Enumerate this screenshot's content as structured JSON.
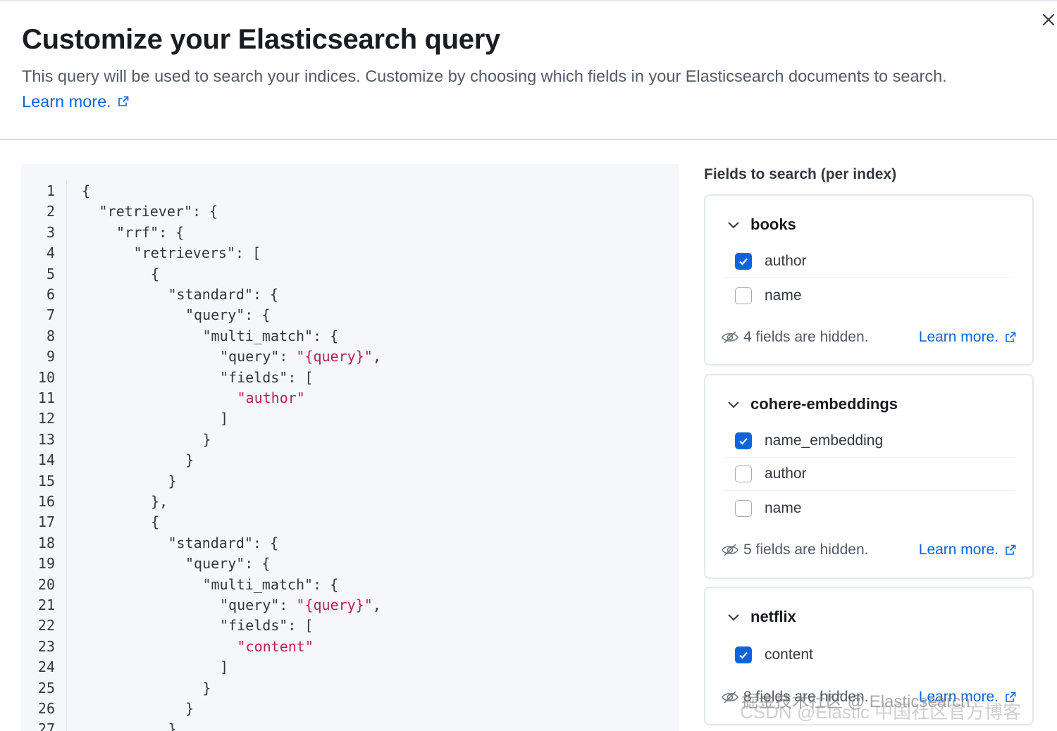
{
  "modal": {
    "title": "Customize your Elasticsearch query",
    "subtitle": "This query will be used to search your indices. Customize by choosing which fields in your Elasticsearch documents to search.",
    "learn_more": "Learn more."
  },
  "editor": {
    "lines": [
      {
        "n": "1",
        "indent": 0,
        "parts": [
          {
            "t": "{"
          }
        ]
      },
      {
        "n": "2",
        "indent": 1,
        "parts": [
          {
            "t": "\"retriever\": {"
          }
        ]
      },
      {
        "n": "3",
        "indent": 2,
        "parts": [
          {
            "t": "\"rrf\": {"
          }
        ]
      },
      {
        "n": "4",
        "indent": 3,
        "parts": [
          {
            "t": "\"retrievers\": ["
          }
        ]
      },
      {
        "n": "5",
        "indent": 4,
        "parts": [
          {
            "t": "{"
          }
        ]
      },
      {
        "n": "6",
        "indent": 5,
        "parts": [
          {
            "t": "\"standard\": {"
          }
        ]
      },
      {
        "n": "7",
        "indent": 6,
        "parts": [
          {
            "t": "\"query\": {"
          }
        ]
      },
      {
        "n": "8",
        "indent": 7,
        "parts": [
          {
            "t": "\"multi_match\": {"
          }
        ]
      },
      {
        "n": "9",
        "indent": 8,
        "parts": [
          {
            "t": "\"query\": "
          },
          {
            "t": "\"{query}\"",
            "s": true
          },
          {
            "t": ","
          }
        ]
      },
      {
        "n": "10",
        "indent": 8,
        "parts": [
          {
            "t": "\"fields\": ["
          }
        ]
      },
      {
        "n": "11",
        "indent": 9,
        "parts": [
          {
            "t": "\"author\"",
            "s": true
          }
        ]
      },
      {
        "n": "12",
        "indent": 8,
        "parts": [
          {
            "t": "]"
          }
        ]
      },
      {
        "n": "13",
        "indent": 7,
        "parts": [
          {
            "t": "}"
          }
        ]
      },
      {
        "n": "14",
        "indent": 6,
        "parts": [
          {
            "t": "}"
          }
        ]
      },
      {
        "n": "15",
        "indent": 5,
        "parts": [
          {
            "t": "}"
          }
        ]
      },
      {
        "n": "16",
        "indent": 4,
        "parts": [
          {
            "t": "},"
          }
        ]
      },
      {
        "n": "17",
        "indent": 4,
        "parts": [
          {
            "t": "{"
          }
        ]
      },
      {
        "n": "18",
        "indent": 5,
        "parts": [
          {
            "t": "\"standard\": {"
          }
        ]
      },
      {
        "n": "19",
        "indent": 6,
        "parts": [
          {
            "t": "\"query\": {"
          }
        ]
      },
      {
        "n": "20",
        "indent": 7,
        "parts": [
          {
            "t": "\"multi_match\": {"
          }
        ]
      },
      {
        "n": "21",
        "indent": 8,
        "parts": [
          {
            "t": "\"query\": "
          },
          {
            "t": "\"{query}\"",
            "s": true
          },
          {
            "t": ","
          }
        ]
      },
      {
        "n": "22",
        "indent": 8,
        "parts": [
          {
            "t": "\"fields\": ["
          }
        ]
      },
      {
        "n": "23",
        "indent": 9,
        "parts": [
          {
            "t": "\"content\"",
            "s": true
          }
        ]
      },
      {
        "n": "24",
        "indent": 8,
        "parts": [
          {
            "t": "]"
          }
        ]
      },
      {
        "n": "25",
        "indent": 7,
        "parts": [
          {
            "t": "}"
          }
        ]
      },
      {
        "n": "26",
        "indent": 6,
        "parts": [
          {
            "t": "}"
          }
        ]
      },
      {
        "n": "27",
        "indent": 5,
        "parts": [
          {
            "t": "}"
          }
        ]
      }
    ]
  },
  "fields_panel": {
    "title": "Fields to search (per index)",
    "indices": [
      {
        "name": "books",
        "fields": [
          {
            "label": "author",
            "checked": true
          },
          {
            "label": "name",
            "checked": false
          }
        ],
        "hidden_text": "4 fields are hidden.",
        "learn_more": "Learn more."
      },
      {
        "name": "cohere-embeddings",
        "fields": [
          {
            "label": "name_embedding",
            "checked": true
          },
          {
            "label": "author",
            "checked": false
          },
          {
            "label": "name",
            "checked": false
          }
        ],
        "hidden_text": "5 fields are hidden.",
        "learn_more": "Learn more."
      },
      {
        "name": "netflix",
        "fields": [
          {
            "label": "content",
            "checked": true
          }
        ],
        "hidden_text": "8 fields are hidden.",
        "learn_more": "Learn more."
      }
    ]
  },
  "watermarks": {
    "line1": "掘金技术社区 @ Elasticsearch",
    "line2": "CSDN @Elastic 中国社区官方博客"
  },
  "colors": {
    "link": "#0b64dd",
    "string": "#b4234e",
    "checkbox_checked": "#0b64dd"
  }
}
